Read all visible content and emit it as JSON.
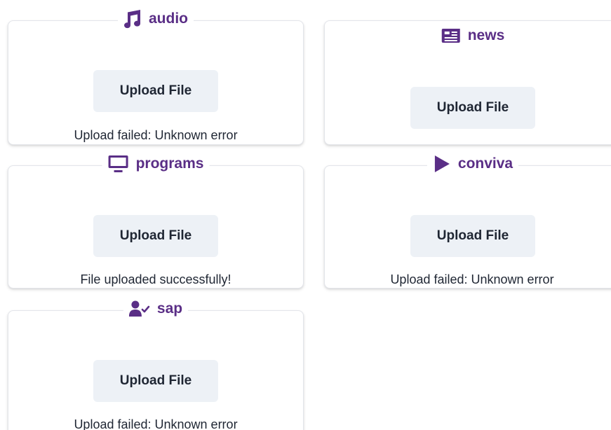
{
  "colors": {
    "accent": "#5a2e86",
    "button_bg": "#edf1f6",
    "text": "#1f2633"
  },
  "cards": [
    {
      "title": "audio",
      "icon": "music-note-icon",
      "button_label": "Upload File",
      "status": "Upload failed: Unknown error"
    },
    {
      "title": "news",
      "icon": "newspaper-icon",
      "button_label": "Upload File",
      "status": ""
    },
    {
      "title": "programs",
      "icon": "monitor-icon",
      "button_label": "Upload File",
      "status": "File uploaded successfully!"
    },
    {
      "title": "conviva",
      "icon": "play-icon",
      "button_label": "Upload File",
      "status": "Upload failed: Unknown error"
    },
    {
      "title": "sap",
      "icon": "user-check-icon",
      "button_label": "Upload File",
      "status": "Upload failed: Unknown error"
    }
  ]
}
